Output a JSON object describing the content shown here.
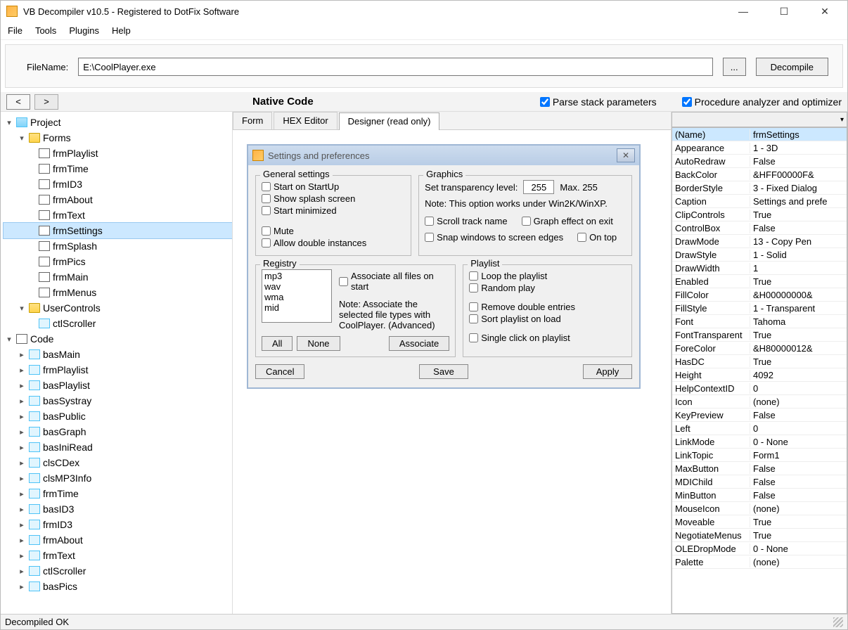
{
  "title": "VB Decompiler v10.5 - Registered to DotFix Software",
  "menu": {
    "file": "File",
    "tools": "Tools",
    "plugins": "Plugins",
    "help": "Help"
  },
  "fileRow": {
    "label": "FileName:",
    "value": "E:\\CoolPlayer.exe",
    "browse": "...",
    "decompile": "Decompile"
  },
  "toolbar": {
    "back": "<",
    "fwd": ">",
    "codeKind": "Native Code",
    "parseStack": "Parse stack parameters",
    "procAnalyzer": "Procedure analyzer and optimizer"
  },
  "tree": {
    "project": "Project",
    "forms": "Forms",
    "formItems": [
      "frmPlaylist",
      "frmTime",
      "frmID3",
      "frmAbout",
      "frmText",
      "frmSettings",
      "frmSplash",
      "frmPics",
      "frmMain",
      "frmMenus"
    ],
    "userControls": "UserControls",
    "ucItems": [
      "ctlScroller"
    ],
    "code": "Code",
    "codeItems": [
      "basMain",
      "frmPlaylist",
      "basPlaylist",
      "basSystray",
      "basPublic",
      "basGraph",
      "basIniRead",
      "clsCDex",
      "clsMP3Info",
      "frmTime",
      "basID3",
      "frmID3",
      "frmAbout",
      "frmText",
      "ctlScroller",
      "basPics"
    ]
  },
  "tabs": {
    "form": "Form",
    "hex": "HEX Editor",
    "designer": "Designer (read only)"
  },
  "dlg": {
    "title": "Settings and preferences",
    "general": {
      "legend": "General settings",
      "startOnStartup": "Start on StartUp",
      "splash": "Show splash screen",
      "startMin": "Start minimized",
      "mute": "Mute",
      "allowDouble": "Allow double instances"
    },
    "graphics": {
      "legend": "Graphics",
      "transLabel": "Set transparency level:",
      "transVal": "255",
      "max": "Max. 255",
      "note": "Note: This option works under Win2K/WinXP.",
      "scroll": "Scroll track name",
      "graphExit": "Graph effect on exit",
      "snap": "Snap windows to screen edges",
      "ontop": "On top"
    },
    "registry": {
      "legend": "Registry",
      "items": [
        "mp3",
        "wav",
        "wma",
        "mid"
      ],
      "assocAll": "Associate all files on start",
      "note": "Note: Associate the selected file types with CoolPlayer. (Advanced)",
      "all": "All",
      "none": "None",
      "associate": "Associate"
    },
    "playlist": {
      "legend": "Playlist",
      "loop": "Loop the playlist",
      "random": "Random play",
      "removeDup": "Remove double entries",
      "sortOnLoad": "Sort playlist on load",
      "single": "Single click on playlist"
    },
    "cancel": "Cancel",
    "save": "Save",
    "apply": "Apply"
  },
  "props": [
    [
      "(Name)",
      "frmSettings"
    ],
    [
      "Appearance",
      "1 - 3D"
    ],
    [
      "AutoRedraw",
      "False"
    ],
    [
      "BackColor",
      "&HFF00000F&"
    ],
    [
      "BorderStyle",
      "3 - Fixed Dialog"
    ],
    [
      "Caption",
      "Settings and prefe"
    ],
    [
      "ClipControls",
      "True"
    ],
    [
      "ControlBox",
      "False"
    ],
    [
      "DrawMode",
      "13 - Copy Pen"
    ],
    [
      "DrawStyle",
      "1 - Solid"
    ],
    [
      "DrawWidth",
      "1"
    ],
    [
      "Enabled",
      "True"
    ],
    [
      "FillColor",
      "&H00000000&"
    ],
    [
      "FillStyle",
      "1 - Transparent"
    ],
    [
      "Font",
      "Tahoma"
    ],
    [
      "FontTransparent",
      "True"
    ],
    [
      "ForeColor",
      "&H80000012&"
    ],
    [
      "HasDC",
      "True"
    ],
    [
      "Height",
      "4092"
    ],
    [
      "HelpContextID",
      "0"
    ],
    [
      "Icon",
      "(none)"
    ],
    [
      "KeyPreview",
      "False"
    ],
    [
      "Left",
      "0"
    ],
    [
      "LinkMode",
      "0 - None"
    ],
    [
      "LinkTopic",
      "Form1"
    ],
    [
      "MaxButton",
      "False"
    ],
    [
      "MDIChild",
      "False"
    ],
    [
      "MinButton",
      "False"
    ],
    [
      "MouseIcon",
      "(none)"
    ],
    [
      "Moveable",
      "True"
    ],
    [
      "NegotiateMenus",
      "True"
    ],
    [
      "OLEDropMode",
      "0 - None"
    ],
    [
      "Palette",
      "(none)"
    ]
  ],
  "status": "Decompiled OK"
}
